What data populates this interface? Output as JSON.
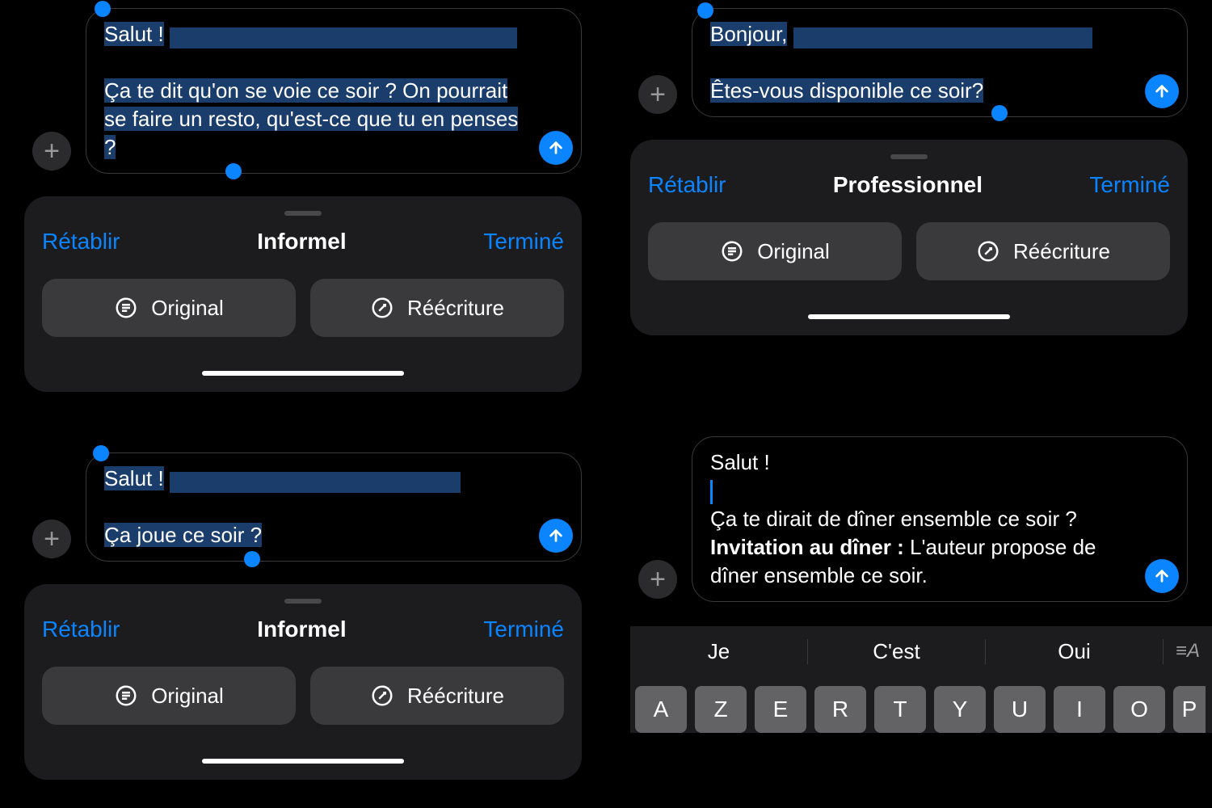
{
  "panels": {
    "a": {
      "message_line1": "Salut !",
      "message_line2": "Ça te dit qu'on se voie ce soir ? On pourrait se faire un resto, qu'est-ce que tu en penses ?",
      "title": "Informel",
      "restore": "Rétablir",
      "done": "Terminé",
      "btn_original": "Original",
      "btn_rewrite": "Réécriture"
    },
    "b": {
      "message_line1": "Bonjour,",
      "message_line2": "Êtes-vous disponible ce soir?",
      "title": "Professionnel",
      "restore": "Rétablir",
      "done": "Terminé",
      "btn_original": "Original",
      "btn_rewrite": "Réécriture"
    },
    "c": {
      "message_line1": "Salut !",
      "message_line2": "Ça joue ce soir ?",
      "title": "Informel",
      "restore": "Rétablir",
      "done": "Terminé",
      "btn_original": "Original",
      "btn_rewrite": "Réécriture"
    },
    "d": {
      "message_line1": "Salut !",
      "message_line2": "Ça te dirait de dîner ensemble ce soir ?",
      "message_line3_bold": "Invitation au dîner :",
      "message_line3_rest": " L'auteur propose de dîner ensemble ce soir.",
      "suggestions": [
        "Je",
        "C'est",
        "Oui"
      ],
      "keys": [
        "A",
        "Z",
        "E",
        "R",
        "T",
        "Y",
        "U",
        "I",
        "O",
        "P"
      ]
    }
  }
}
